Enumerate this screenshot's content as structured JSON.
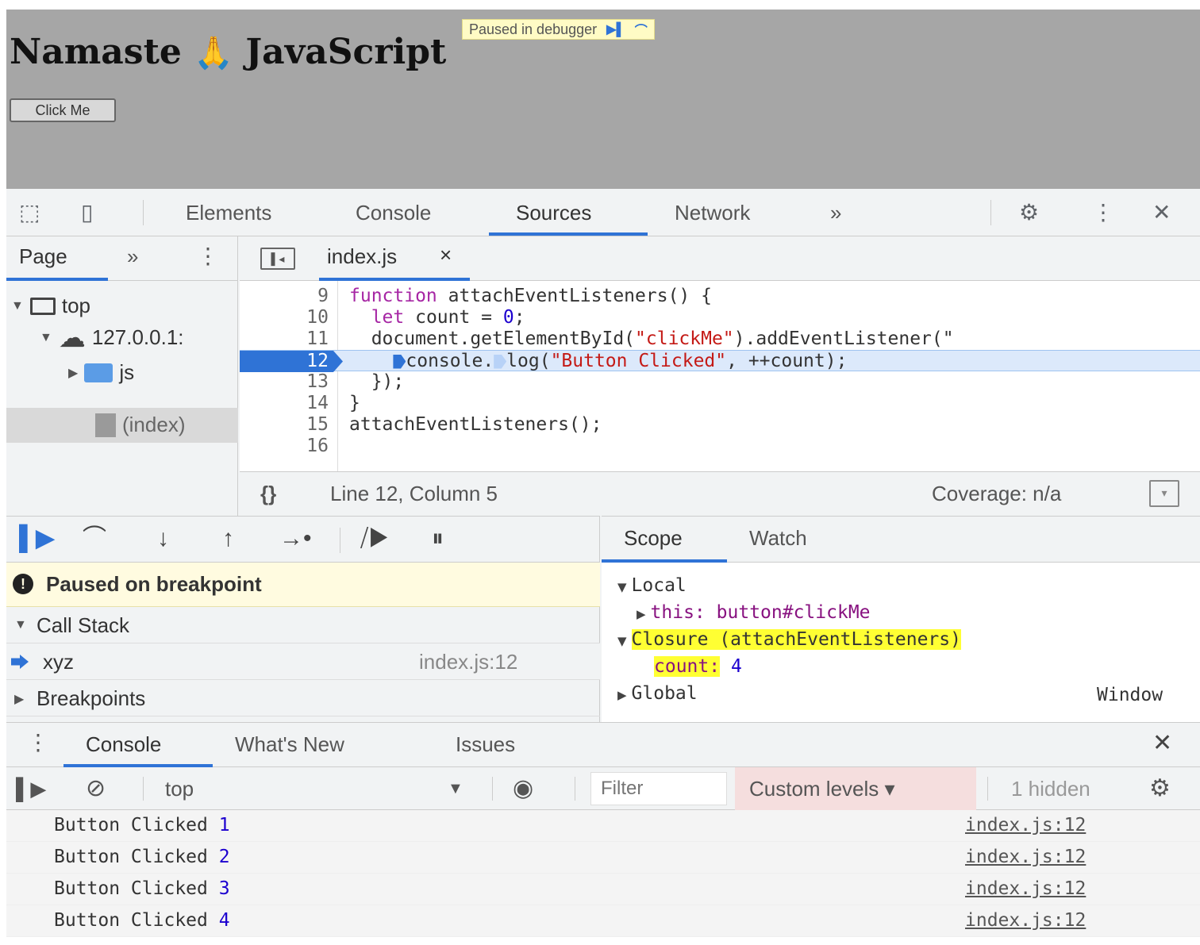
{
  "page": {
    "title_left": "Namaste",
    "emoji": "🙏",
    "title_right": "JavaScript",
    "button_label": "Click Me",
    "paused_badge": "Paused in debugger"
  },
  "devtools": {
    "tabs": [
      "Elements",
      "Console",
      "Sources",
      "Network"
    ],
    "more": "»"
  },
  "navigator": {
    "tab_label": "Page",
    "more": "»",
    "tree": [
      "top",
      "127.0.0.1:",
      "js",
      "(index)"
    ]
  },
  "editor": {
    "file_tab": "index.js",
    "lines": [
      {
        "num": "9",
        "code": "function attachEventListeners() {"
      },
      {
        "num": "10",
        "code": "  let count = 0;"
      },
      {
        "num": "11",
        "code": "  document.getElementById(\"clickMe\").addEventListener(\""
      },
      {
        "num": "12",
        "code": "    console.log(\"Button Clicked\", ++count);"
      },
      {
        "num": "13",
        "code": "  });"
      },
      {
        "num": "14",
        "code": "}"
      },
      {
        "num": "15",
        "code": "attachEventListeners();"
      },
      {
        "num": "16",
        "code": ""
      }
    ],
    "current_line": "12",
    "status_braces": "{}",
    "status_position": "Line 12, Column 5",
    "coverage": "Coverage: n/a"
  },
  "debugger": {
    "paused_message": "Paused on breakpoint",
    "call_stack_label": "Call Stack",
    "call_stack": [
      {
        "fn": "xyz",
        "location": "index.js:12"
      }
    ],
    "breakpoints_label": "Breakpoints"
  },
  "scope": {
    "tabs": [
      "Scope",
      "Watch"
    ],
    "local_label": "Local",
    "this_key": "this:",
    "this_value": "button#clickMe",
    "closure_label": "Closure (attachEventListeners)",
    "count_key": "count:",
    "count_value": "4",
    "global_label": "Global",
    "global_value": "Window"
  },
  "console": {
    "tabs": [
      "Console",
      "What's New",
      "Issues"
    ],
    "context": "top",
    "filter_placeholder": "Filter",
    "levels": "Custom levels ▾",
    "hidden": "1 hidden",
    "logs": [
      {
        "text": "Button Clicked",
        "count": "1",
        "source": "index.js:12"
      },
      {
        "text": "Button Clicked",
        "count": "2",
        "source": "index.js:12"
      },
      {
        "text": "Button Clicked",
        "count": "3",
        "source": "index.js:12"
      },
      {
        "text": "Button Clicked",
        "count": "4",
        "source": "index.js:12"
      }
    ]
  },
  "colors": {
    "accent": "#2f73d6",
    "highlight": "#ffff33",
    "paused_bg": "#fffbe0"
  }
}
